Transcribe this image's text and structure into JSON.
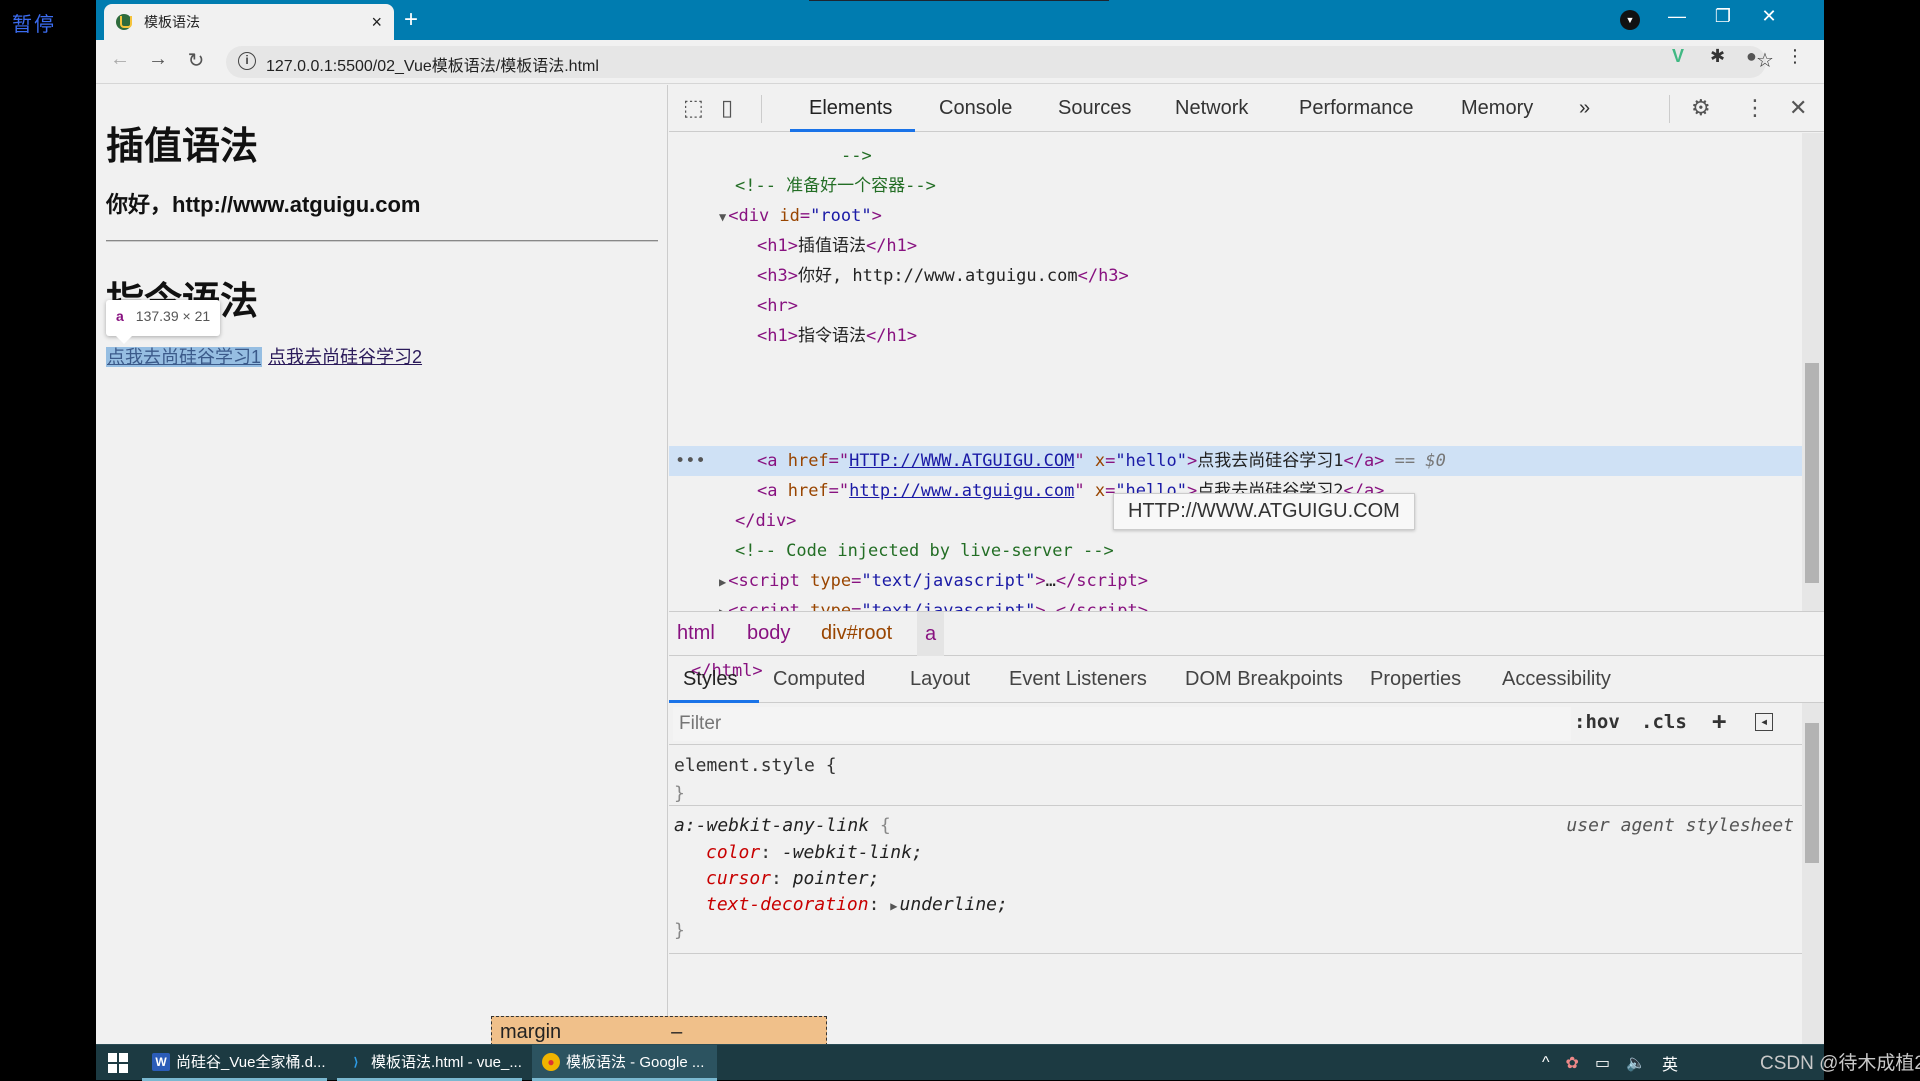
{
  "overlay": {
    "pause_label": "暂停",
    "watermark": "CSDN @待木成植2"
  },
  "browser": {
    "tab": {
      "title": "模板语法",
      "close": "×"
    },
    "new_tab": "+",
    "window_controls": {
      "minimize": "—",
      "restore": "❐",
      "close": "✕"
    },
    "nav": {
      "back": "←",
      "forward": "→",
      "reload": "↻"
    },
    "url": "127.0.0.1:5500/02_Vue模板语法/模板语法.html",
    "info_icon": "i",
    "star_icon": "☆",
    "extensions": {
      "vue": "V",
      "puzzle": "✱",
      "profile": "●",
      "menu": "⋮"
    }
  },
  "page": {
    "h1_interpolation": "插值语法",
    "h3_greeting": "你好，http://www.atguigu.com",
    "h1_directive": "指令语法",
    "inspect_tooltip": {
      "tag": "a",
      "size": "137.39 × 21"
    },
    "links": [
      "点我去尚硅谷学习1",
      "点我去尚硅谷学习2"
    ]
  },
  "devtools": {
    "tabs": [
      "Elements",
      "Console",
      "Sources",
      "Network",
      "Performance",
      "Memory"
    ],
    "active_tab": "Elements",
    "more_tabs": "»",
    "icons": {
      "inspect": "⬚",
      "device": "▯",
      "settings": "⚙",
      "menu": "⋮",
      "close": "✕"
    },
    "dom": {
      "l0": "-->",
      "l1_comment": "<!-- 准备好一个容器-->",
      "l2_tag_open": "<div ",
      "l2_attr": "id",
      "l2_val": "\"root\"",
      "l2_close": ">",
      "l3_text": "插值语法",
      "l4_text": "你好, http://www.atguigu.com",
      "l6_text": "指令语法",
      "a1_href": "HTTP://WWW.ATGUIGU.COM",
      "a1_x": "\"hello\"",
      "a1_text": "点我去尚硅谷学习1",
      "a1_suffix": "== $0",
      "a2_href": "http://www.atguigu.com",
      "a2_x": "\"hello\"",
      "a2_text": "点我去尚硅谷学习2",
      "live_server_comment": "<!-- Code injected by live-server -->",
      "script_type": "\"text/javascript\"",
      "ellipsis": "…",
      "row_dots": "•••"
    },
    "href_tooltip": "HTTP://WWW.ATGUIGU.COM",
    "breadcrumbs": [
      "html",
      "body",
      "div#root",
      "a"
    ],
    "sub_tabs": [
      "Styles",
      "Computed",
      "Layout",
      "Event Listeners",
      "DOM Breakpoints",
      "Properties",
      "Accessibility"
    ],
    "active_sub_tab": "Styles",
    "filter_placeholder": "Filter",
    "filter_buttons": {
      "hov": ":hov",
      "cls": ".cls",
      "add": "+",
      "toggle": "◂"
    },
    "styles": {
      "element_style": "element.style {",
      "close_brace": "}",
      "ua_selector": "a:-webkit-any-link",
      "ua_label": "user agent stylesheet",
      "props": [
        {
          "name": "color",
          "value": "-webkit-link;"
        },
        {
          "name": "cursor",
          "value": "pointer;"
        },
        {
          "name": "text-decoration",
          "value": "underline;"
        }
      ]
    },
    "box_model": {
      "label": "margin",
      "value": "–"
    }
  },
  "taskbar": {
    "items": [
      {
        "label": "尚硅谷_Vue全家桶.d...",
        "icon": "word-icon"
      },
      {
        "label": "模板语法.html - vue_...",
        "icon": "vscode-icon"
      },
      {
        "label": "模板语法 - Google ...",
        "icon": "chrome-icon"
      }
    ],
    "tray": {
      "chevron": "^",
      "ime": "英"
    }
  },
  "colors": {
    "titlebar": "#007cb0",
    "selection": "#cfe1f5",
    "taskbar": "#1c3a42",
    "accent": "#1a73e8"
  }
}
